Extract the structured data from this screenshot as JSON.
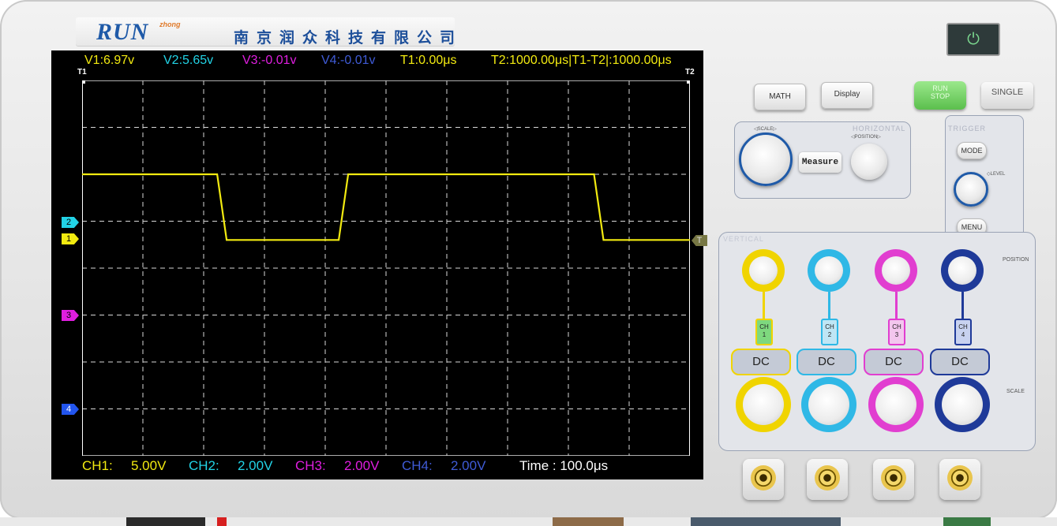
{
  "brand": {
    "logo_text": "RUN",
    "logo_superscript": "zhong",
    "company_name": "南京润众科技有限公司"
  },
  "readouts": {
    "v1": "V1:6.97v",
    "v2": "V2:5.65v",
    "v3": "V3:-0.01v",
    "v4": "V4:-0.01v",
    "t1": "T1:0.00μs",
    "t2_diff": "T2:1000.00μs|T1-T2|:1000.00μs"
  },
  "cursor_labels": {
    "t1": "T1",
    "t2": "T2"
  },
  "channel_markers": [
    {
      "label": "2",
      "color": "#22d3e6"
    },
    {
      "label": "1",
      "color": "#f2ea10"
    },
    {
      "label": "3",
      "color": "#e01ee0"
    },
    {
      "label": "4",
      "color": "#2255ee"
    }
  ],
  "trigger_marker": "T",
  "scale_bar": {
    "ch1_label": "CH1:",
    "ch1_value": "5.00V",
    "ch2_label": "CH2:",
    "ch2_value": "2.00V",
    "ch3_label": "CH3:",
    "ch3_value": "2.00V",
    "ch4_label": "CH4:",
    "ch4_value": "2.00V",
    "time": "Time : 100.0μs"
  },
  "colors": {
    "ch1": "#f2ea10",
    "ch2": "#22d3e6",
    "ch3": "#e01ee0",
    "ch4": "#2255ee",
    "ch4_text": "#3f5bd6",
    "grid": "#d8d8d8",
    "waveform": "#f2ea10"
  },
  "buttons": {
    "math": "MATH",
    "display": "Display",
    "run_stop_line1": "RUN",
    "run_stop_line2": "STOP",
    "single": "SINGLE",
    "measure": "Measure",
    "mode": "MODE",
    "menu": "MENU",
    "power_icon": "⏻"
  },
  "panels": {
    "horizontal": "HORIZONTAL",
    "h_scale": "◁SCALE▷",
    "h_position": "◁POSITION▷",
    "trigger": "TRIGGER",
    "level": "◇LEVEL",
    "vertical": "VERTICAL",
    "position": "POSITION",
    "scale": "SCALE"
  },
  "channels": [
    {
      "line1": "CH",
      "line2": "1",
      "coupling": "DC",
      "color": "#f0d400",
      "badge_bg": "#7ed87e"
    },
    {
      "line1": "CH",
      "line2": "2",
      "coupling": "DC",
      "color": "#2fb8e6",
      "badge_bg": "#bfe6f5"
    },
    {
      "line1": "CH",
      "line2": "3",
      "coupling": "DC",
      "color": "#e13ed0",
      "badge_bg": "#f3c6ee"
    },
    {
      "line1": "CH",
      "line2": "4",
      "coupling": "DC",
      "color": "#1f3a99",
      "badge_bg": "#c8d2f0"
    }
  ],
  "waveform": {
    "channel": "CH1",
    "type": "square",
    "high_level_div": 2.0,
    "low_level_div": 3.4,
    "transitions_us": [
      230,
      430,
      850,
      1030
    ]
  }
}
